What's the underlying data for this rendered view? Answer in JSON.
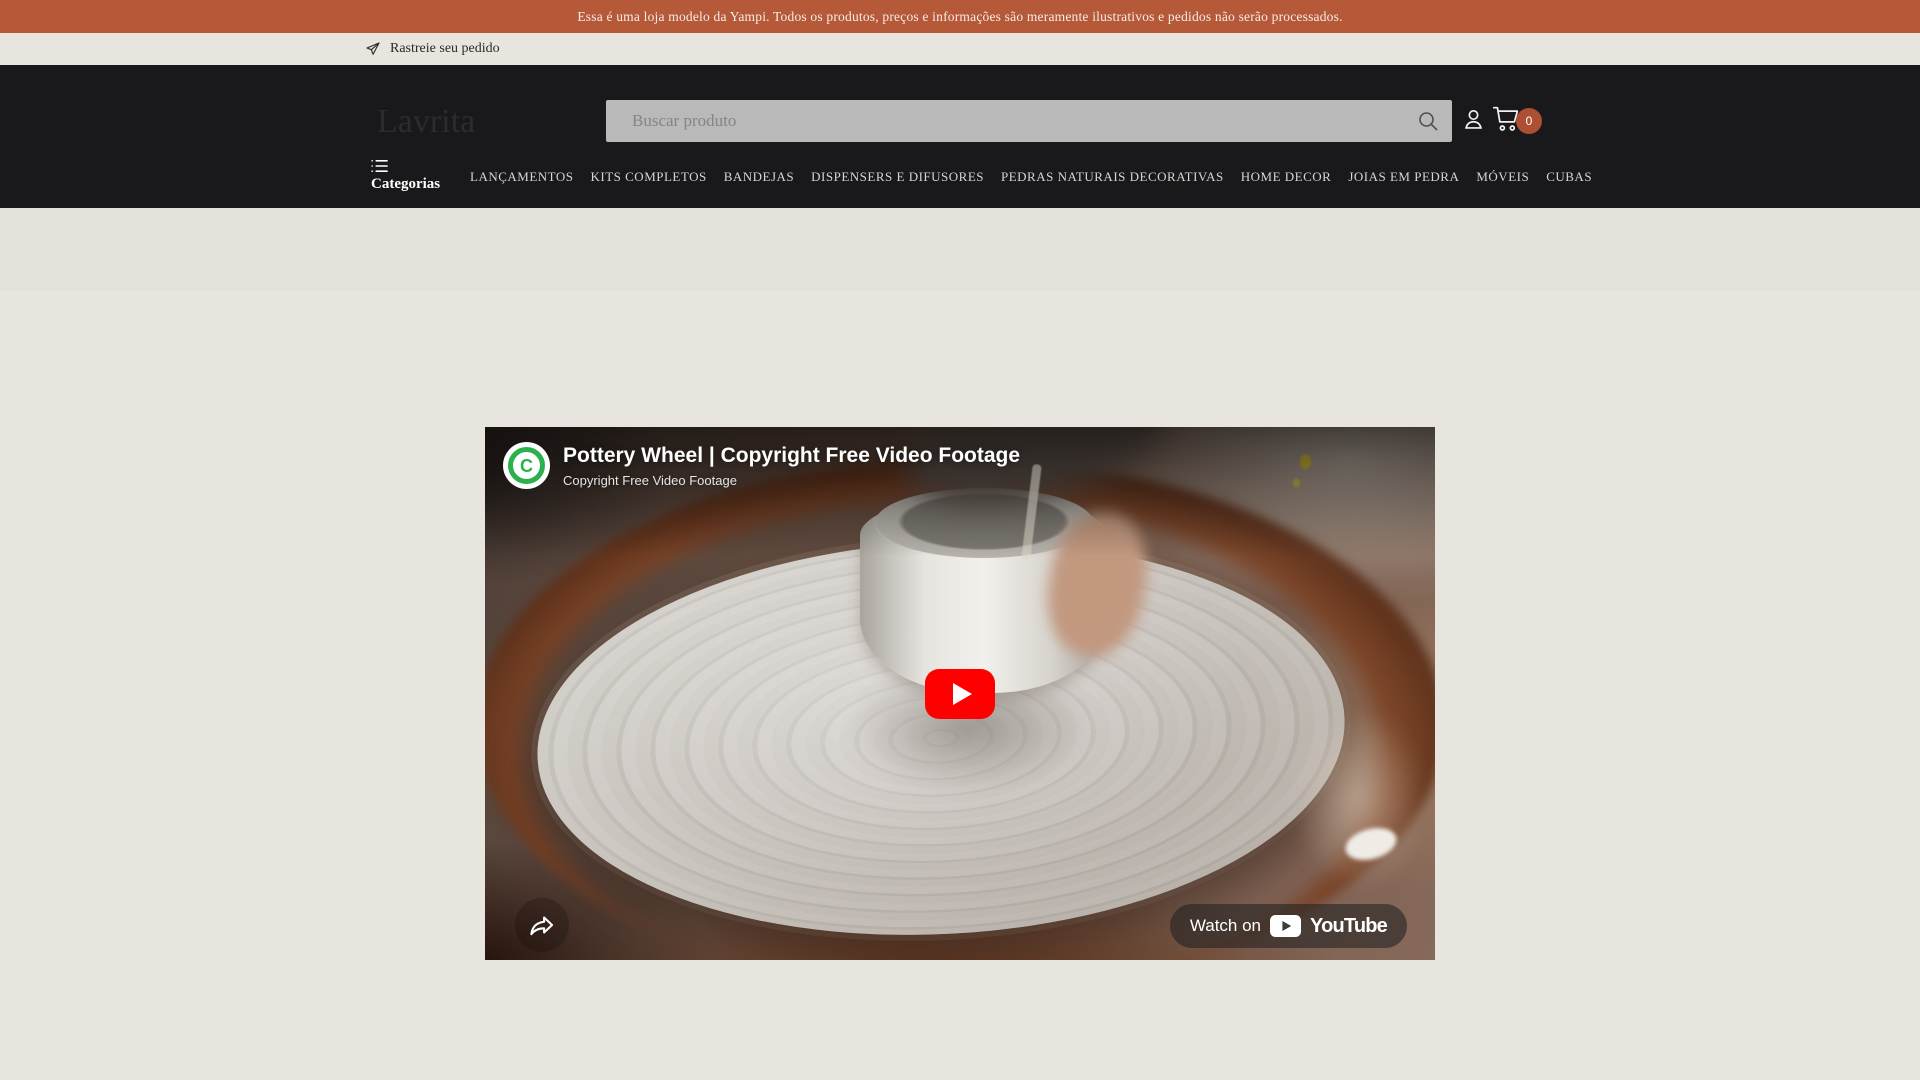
{
  "banner": {
    "text": "Essa é uma loja modelo da Yampi. Todos os produtos, preços e informações são meramente ilustrativos e pedidos não serão processados."
  },
  "utility_bar": {
    "track_order_label": "Rastreie seu pedido"
  },
  "header": {
    "logo": "Lavrita",
    "search": {
      "placeholder": "Buscar produto"
    },
    "cart": {
      "count": "0"
    },
    "categories_label": "Categorias",
    "nav": [
      {
        "label": "LANÇAMENTOS"
      },
      {
        "label": "KITS COMPLETOS"
      },
      {
        "label": "BANDEJAS"
      },
      {
        "label": "DISPENSERS E DIFUSORES"
      },
      {
        "label": "PEDRAS NATURAIS DECORATIVAS"
      },
      {
        "label": "HOME DECOR"
      },
      {
        "label": "JOIAS EM PEDRA"
      },
      {
        "label": "MÓVEIS"
      },
      {
        "label": "CUBAS"
      }
    ]
  },
  "video": {
    "title": "Pottery Wheel | Copyright Free Video Footage",
    "channel": "Copyright Free Video Footage",
    "avatar_letter": "C",
    "watch_on_label": "Watch on",
    "youtube_wordmark": "YouTube"
  },
  "colors": {
    "banner_bg": "#b65939",
    "utility_bg": "#e8e5df",
    "header_bg": "#19181a",
    "page_bg": "#e8e5df",
    "strip_bg": "#e4e0da",
    "search_bg": "#b9b9b9",
    "badge_bg": "#ad4f33",
    "play_red": "#ff0000",
    "avatar_green": "#2bb14c"
  }
}
